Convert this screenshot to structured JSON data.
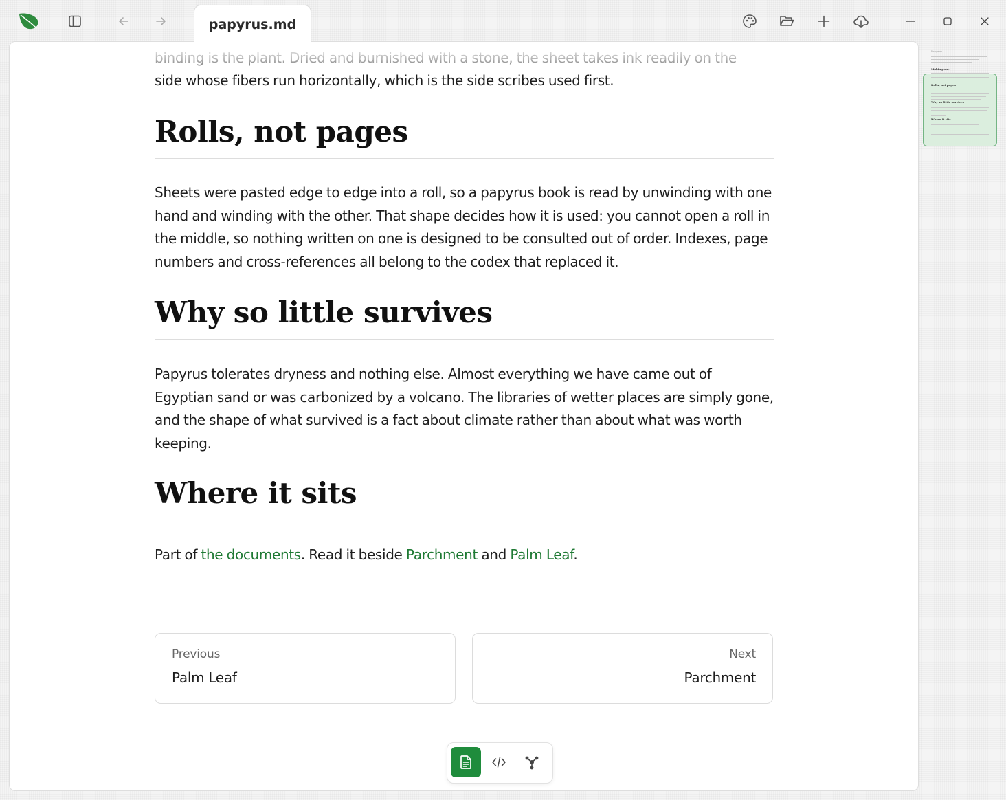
{
  "window": {
    "tab_title": "papyrus.md"
  },
  "titlebar": {
    "icons": {
      "logo": "leaf-icon",
      "sidebar_toggle": "sidebar-toggle-icon",
      "back": "arrow-left-icon",
      "forward": "arrow-right-icon",
      "theme": "palette-icon",
      "open": "folder-open-icon",
      "new": "plus-icon",
      "download": "cloud-download-icon",
      "minimize": "minimize-icon",
      "maximize": "maximize-icon",
      "close": "close-icon"
    }
  },
  "colors": {
    "accent": "#1f8c3c",
    "link": "#1f7a34",
    "logo": "#2e8b3e"
  },
  "document": {
    "intro_faded": "binding is the plant. Dried and burnished with a stone, the sheet takes ink readily on the",
    "intro_line": "side whose fibers run horizontally, which is the side scribes used first.",
    "sections": [
      {
        "heading": "Rolls, not pages",
        "paragraph": "Sheets were pasted edge to edge into a roll, so a papyrus book is read by unwinding with one hand and winding with the other. That shape decides how it is used: you cannot open a roll in the middle, so nothing written on one is designed to be consulted out of order. Indexes, page numbers and cross-references all belong to the codex that replaced it."
      },
      {
        "heading": "Why so little survives",
        "paragraph": "Papyrus tolerates dryness and nothing else. Almost everything we have came out of Egyptian sand or was carbonized by a volcano. The libraries of wetter places are simply gone, and the shape of what survived is a fact about climate rather than about what was worth keeping."
      },
      {
        "heading": "Where it sits"
      }
    ],
    "where_it_sits": {
      "prefix": "Part of ",
      "link1": "the documents",
      "middle": ". Read it beside ",
      "link2": "Parchment",
      "and": " and ",
      "link3": "Palm Leaf",
      "suffix": "."
    },
    "nav": {
      "previous_label": "Previous",
      "previous_title": "Palm Leaf",
      "next_label": "Next",
      "next_title": "Parchment"
    }
  },
  "minimap": {
    "title": "Papyrus",
    "headings": [
      "Making one",
      "Rolls, not pages",
      "Why so little survives",
      "Where it sits"
    ]
  },
  "view_switcher": {
    "active": "document",
    "icons": [
      "document-icon",
      "code-icon",
      "graph-icon"
    ]
  }
}
